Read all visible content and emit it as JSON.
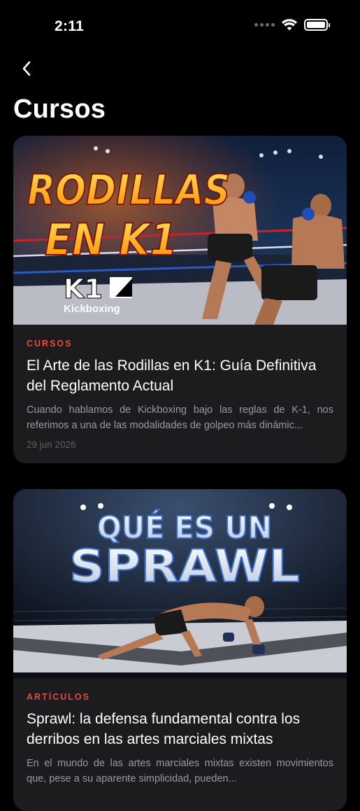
{
  "status_bar": {
    "time": "2:11"
  },
  "header": {
    "title": "Cursos"
  },
  "cards": [
    {
      "image_headline_1": "RODILLAS",
      "image_headline_2": "EN K1",
      "image_logo": "K1",
      "image_logo_sub": "Kickboxing",
      "category": "CURSOS",
      "title": "El Arte de las Rodillas en K1: Guía Definitiva del Reglamento Actual",
      "excerpt": "Cuando hablamos de Kickboxing bajo las reglas de K-1, nos referimos a una de las modalidades de golpeo más dinámic...",
      "date": "29 jun 2026"
    },
    {
      "image_headline_1": "QUÉ ES UN",
      "image_headline_2": "SPRAWL",
      "category": "ARTÍCULOS",
      "title": "Sprawl: la defensa fundamental contra los derribos en las artes marciales mixtas",
      "excerpt": "En el mundo de las artes marciales mixtas existen movimientos que, pese a su aparente simplicidad, pueden...",
      "date": ""
    }
  ],
  "colors": {
    "background": "#000000",
    "card": "#1c1c1e",
    "accent": "#f0473e"
  }
}
